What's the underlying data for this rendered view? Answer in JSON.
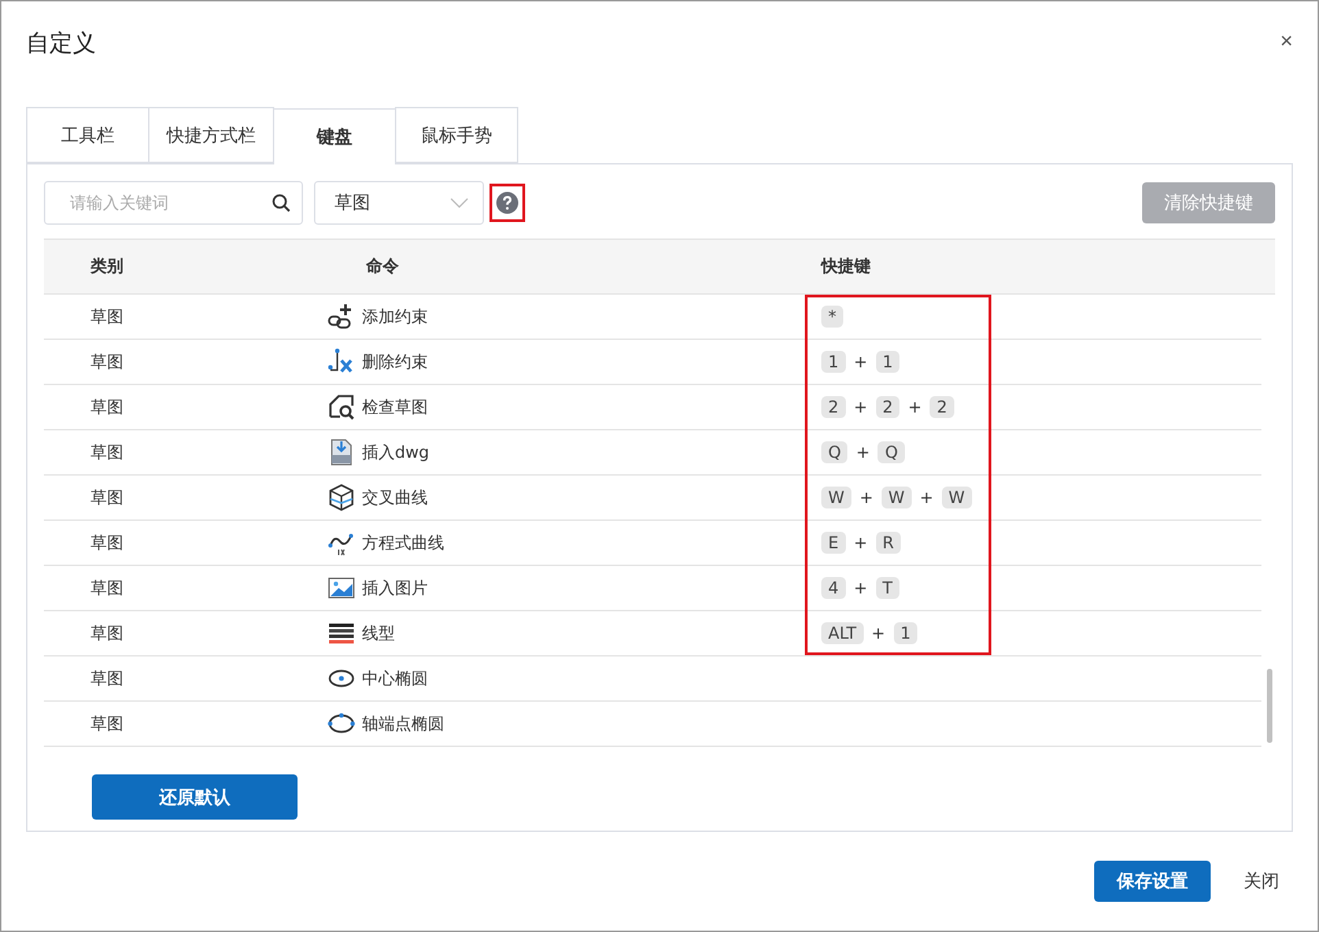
{
  "window": {
    "title": "自定义",
    "close": "×"
  },
  "tabs": [
    {
      "label": "工具栏",
      "selected": false
    },
    {
      "label": "快捷方式栏",
      "selected": false
    },
    {
      "label": "键盘",
      "selected": true
    },
    {
      "label": "鼠标手势",
      "selected": false
    }
  ],
  "search": {
    "placeholder": "请输入关键词"
  },
  "category_select": {
    "value": "草图"
  },
  "help": {
    "highlighted": true
  },
  "clear_button": {
    "label": "清除快捷键",
    "disabled": true
  },
  "table": {
    "columns": [
      "类别",
      "命令",
      "快捷键"
    ],
    "shortcuts_highlighted": true,
    "rows": [
      {
        "category": "草图",
        "command": "添加约束",
        "shortcut": [
          {
            "kind": "key",
            "text": "*"
          }
        ]
      },
      {
        "category": "草图",
        "command": "删除约束",
        "shortcut": [
          {
            "kind": "key",
            "text": "1"
          },
          {
            "kind": "plus",
            "text": "+"
          },
          {
            "kind": "key",
            "text": "1"
          }
        ]
      },
      {
        "category": "草图",
        "command": "检查草图",
        "shortcut": [
          {
            "kind": "key",
            "text": "2"
          },
          {
            "kind": "plus",
            "text": "+"
          },
          {
            "kind": "key",
            "text": "2"
          },
          {
            "kind": "plus",
            "text": "+"
          },
          {
            "kind": "key",
            "text": "2"
          }
        ]
      },
      {
        "category": "草图",
        "command": "插入dwg",
        "shortcut": [
          {
            "kind": "key",
            "text": "Q"
          },
          {
            "kind": "plus",
            "text": "+"
          },
          {
            "kind": "key",
            "text": "Q"
          }
        ]
      },
      {
        "category": "草图",
        "command": "交叉曲线",
        "shortcut": [
          {
            "kind": "key",
            "text": "W"
          },
          {
            "kind": "plus",
            "text": "+"
          },
          {
            "kind": "key",
            "text": "W"
          },
          {
            "kind": "plus",
            "text": "+"
          },
          {
            "kind": "key",
            "text": "W"
          }
        ]
      },
      {
        "category": "草图",
        "command": "方程式曲线",
        "shortcut": [
          {
            "kind": "key",
            "text": "E"
          },
          {
            "kind": "plus",
            "text": "+"
          },
          {
            "kind": "key",
            "text": "R"
          }
        ]
      },
      {
        "category": "草图",
        "command": "插入图片",
        "shortcut": [
          {
            "kind": "key",
            "text": "4"
          },
          {
            "kind": "plus",
            "text": "+"
          },
          {
            "kind": "key",
            "text": "T"
          }
        ]
      },
      {
        "category": "草图",
        "command": "线型",
        "shortcut": [
          {
            "kind": "key",
            "text": "ALT"
          },
          {
            "kind": "plus",
            "text": "+"
          },
          {
            "kind": "key",
            "text": "1"
          }
        ]
      },
      {
        "category": "草图",
        "command": "中心椭圆",
        "shortcut": []
      },
      {
        "category": "草图",
        "command": "轴端点椭圆",
        "shortcut": []
      }
    ]
  },
  "restore_button": {
    "label": "还原默认"
  },
  "footer": {
    "save": "保存设置",
    "close": "关闭"
  }
}
